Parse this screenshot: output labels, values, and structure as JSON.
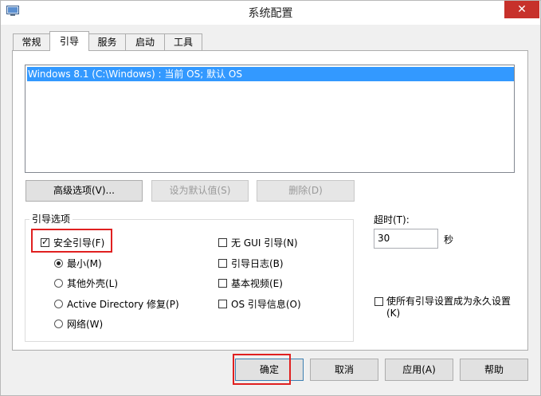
{
  "window": {
    "title": "系统配置",
    "close_label": "✕"
  },
  "tabs": [
    {
      "label": "常规",
      "active": false
    },
    {
      "label": "引导",
      "active": true
    },
    {
      "label": "服务",
      "active": false
    },
    {
      "label": "启动",
      "active": false
    },
    {
      "label": "工具",
      "active": false
    }
  ],
  "os_list": {
    "items": [
      "Windows 8.1 (C:\\Windows) : 当前 OS; 默认 OS"
    ],
    "selected_index": 0
  },
  "buttons": {
    "advanced": "高级选项(V)...",
    "set_default": "设为默认值(S)",
    "delete": "删除(D)",
    "ok": "确定",
    "cancel": "取消",
    "apply": "应用(A)",
    "help": "帮助"
  },
  "boot_options": {
    "group_label": "引导选项",
    "safe_boot": {
      "label": "安全引导(F)",
      "checked": true
    },
    "modes": [
      {
        "label": "最小(M)",
        "checked": true
      },
      {
        "label": "其他外壳(L)",
        "checked": false
      },
      {
        "label": "Active Directory 修复(P)",
        "checked": false
      },
      {
        "label": "网络(W)",
        "checked": false
      }
    ],
    "flags": [
      {
        "label": "无 GUI 引导(N)",
        "checked": false
      },
      {
        "label": "引导日志(B)",
        "checked": false
      },
      {
        "label": "基本视频(E)",
        "checked": false
      },
      {
        "label": "OS 引导信息(O)",
        "checked": false
      }
    ]
  },
  "timeout": {
    "label": "超时(T):",
    "value": "30",
    "unit": "秒"
  },
  "permanent": {
    "label_line1": "使所有引导设置成为永久设置",
    "label_line2": "(K)",
    "checked": false
  }
}
